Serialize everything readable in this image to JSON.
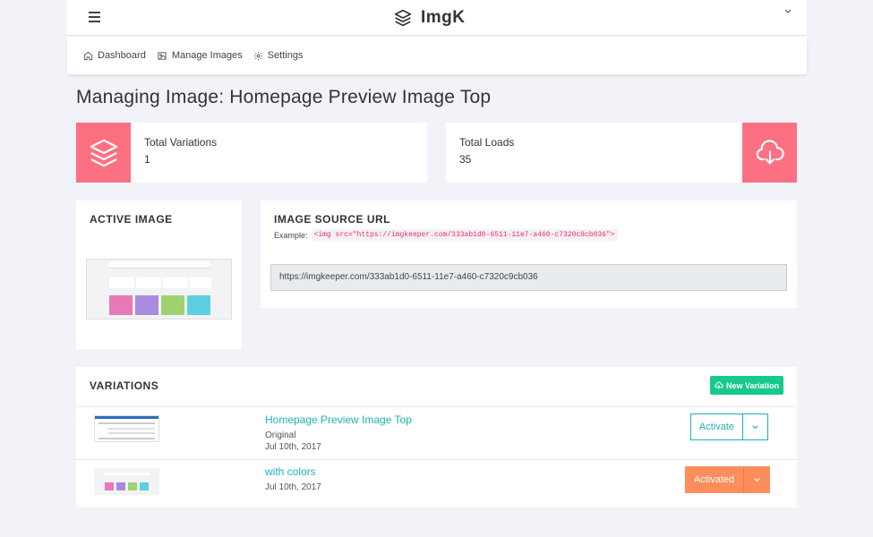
{
  "app": {
    "brand": "ImgK"
  },
  "nav": {
    "items": [
      {
        "label": "Dashboard",
        "icon": "home-icon"
      },
      {
        "label": "Manage Images",
        "icon": "image-icon"
      },
      {
        "label": "Settings",
        "icon": "gear-icon"
      }
    ]
  },
  "page": {
    "title": "Managing Image: Homepage Preview Image Top"
  },
  "stats": {
    "variations": {
      "label": "Total Variations",
      "value": "1",
      "icon": "layers-icon"
    },
    "loads": {
      "label": "Total Loads",
      "value": "35",
      "icon": "cloud-download-icon"
    },
    "accent_color": "#fb7182"
  },
  "active_image": {
    "title": "ACTIVE IMAGE"
  },
  "source": {
    "title": "IMAGE SOURCE URL",
    "example_label": "Example:",
    "example_code": "<img src=\"https://imgkeeper.com/333ab1d0-6511-11e7-a460-c7320c9cb036\">",
    "url": "https://imgkeeper.com/333ab1d0-6511-11e7-a460-c7320c9cb036"
  },
  "variations": {
    "title": "VARIATIONS",
    "new_button": "New Variation",
    "rows": [
      {
        "name": "Homepage Preview Image Top",
        "tag": "Original",
        "date": "Jul 10th, 2017",
        "action": "Activate"
      },
      {
        "name": "with colors",
        "date": "Jul 10th, 2017",
        "action": "Activated"
      }
    ]
  },
  "colors": {
    "teal": "#1eb2b8",
    "green": "#17c98e",
    "orange": "#fd8d5a",
    "pink": "#fb7182"
  }
}
